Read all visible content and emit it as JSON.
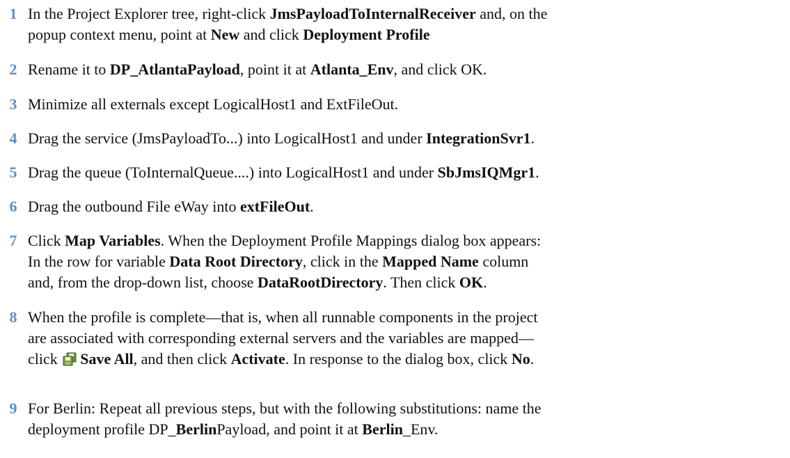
{
  "steps": [
    {
      "number": "1",
      "line1": {
        "t1": "In the Project Explorer tree, right-click ",
        "b1": "JmsPayloadToInternalReceiver",
        "t2": " and, on the"
      },
      "line2": {
        "t1": "popup context menu, point at ",
        "b1": "New",
        "t2": " and click ",
        "b2": "Deployment Profile"
      }
    },
    {
      "number": "2",
      "t1": "Rename it to ",
      "b1": "DP_AtlantaPayload",
      "t2": ", point it at ",
      "b2": "Atlanta_Env",
      "t3": ", and click OK."
    },
    {
      "number": "3",
      "t1": "Minimize all externals except LogicalHost1 and ExtFileOut."
    },
    {
      "number": "4",
      "t1": "Drag the service (JmsPayloadTo...) into LogicalHost1 and under ",
      "b1": "IntegrationSvr1",
      "t2": "."
    },
    {
      "number": "5",
      "t1": "Drag the queue (ToInternalQueue....) into LogicalHost1 and under ",
      "b1": "SbJmsIQMgr1",
      "t2": "."
    },
    {
      "number": "6",
      "t1": "Drag the outbound File eWay into ",
      "b1": "extFileOut",
      "t2": "."
    },
    {
      "number": "7",
      "line1": {
        "t1": "Click ",
        "b1": "Map Variables",
        "t2": ". When the Deployment Profile Mappings dialog box appears:"
      },
      "line2": {
        "t1": "In the row for variable ",
        "b1": "Data Root Directory",
        "t2": ", click in the ",
        "b2": "Mapped Name",
        "t3": " column"
      },
      "line3": {
        "t1": "and, from the drop-down list, choose ",
        "b1": "DataRootDirectory",
        "t2": ". Then click ",
        "b2": "OK",
        "t3": "."
      }
    },
    {
      "number": "8",
      "line1": {
        "t1": "When the profile is complete—that is, when all runnable components in the project"
      },
      "line2": {
        "t1": "are associated with corresponding external servers and the variables are mapped—"
      },
      "line3": {
        "t1": "click ",
        "icon": "save-all-icon",
        "b1": "Save All",
        "t2": ", and then click ",
        "b2": "Activate",
        "t3": ". In response to the dialog box, click ",
        "b3": "No",
        "t4": "."
      }
    },
    {
      "number": "9",
      "line1": {
        "t1": "For Berlin: Repeat all previous steps, but with the following substitutions: name the"
      },
      "line2": {
        "t1": "deployment profile DP_",
        "b1": "Berlin",
        "t2": "Payload, and point it at ",
        "b2": "Berlin",
        "t3": "_Env."
      }
    }
  ],
  "colors": {
    "step_number": "#5c8ec4",
    "text": "#111111"
  }
}
